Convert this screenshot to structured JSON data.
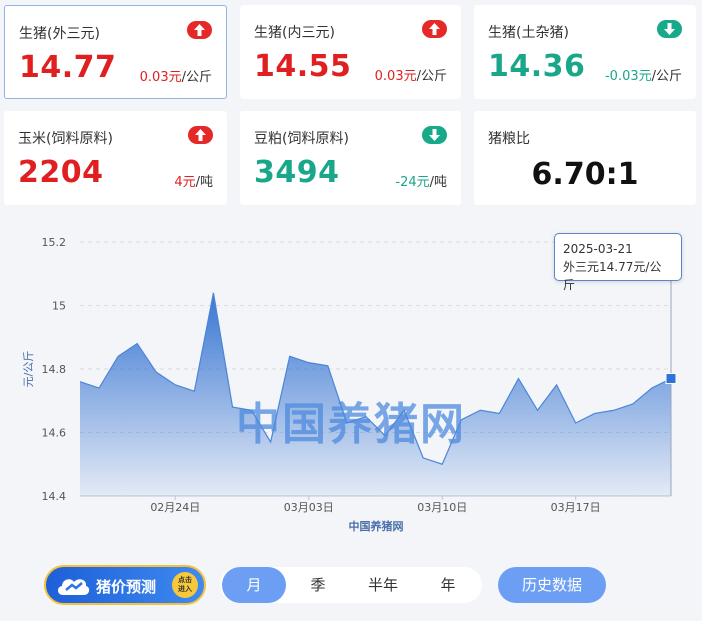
{
  "cards": [
    {
      "label": "生猪(外三元)",
      "value": "14.77",
      "change": "0.03元",
      "unit": "/公斤",
      "trend": "up"
    },
    {
      "label": "生猪(内三元)",
      "value": "14.55",
      "change": "0.03元",
      "unit": "/公斤",
      "trend": "up"
    },
    {
      "label": "生猪(土杂猪)",
      "value": "14.36",
      "change": "-0.03元",
      "unit": "/公斤",
      "trend": "down"
    },
    {
      "label": "玉米(饲料原料)",
      "value": "2204",
      "change": "4元",
      "unit": "/吨",
      "trend": "up"
    },
    {
      "label": "豆粕(饲料原料)",
      "value": "3494",
      "change": "-24元",
      "unit": "/吨",
      "trend": "down"
    },
    {
      "label": "猪粮比",
      "value": "6.70:1"
    }
  ],
  "tooltip": {
    "date": "2025-03-21",
    "text": "外三元14.77元/公斤"
  },
  "watermark": "中国养猪网",
  "promo": {
    "text": "猪价预测",
    "badge_line1": "点击",
    "badge_line2": "进入"
  },
  "range_tabs": [
    {
      "label": "月",
      "active": true
    },
    {
      "label": "季",
      "active": false
    },
    {
      "label": "半年",
      "active": false
    },
    {
      "label": "年",
      "active": false
    }
  ],
  "history_button": "历史数据",
  "chart_data": {
    "type": "area",
    "ylabel": "元/公斤",
    "xlabel": "中国养猪网",
    "ylim": [
      14.4,
      15.2
    ],
    "yticks": [
      14.4,
      14.6,
      14.8,
      15,
      15.2
    ],
    "xticks": [
      {
        "label": "02月24日",
        "index": 5
      },
      {
        "label": "03月03日",
        "index": 12
      },
      {
        "label": "03月10日",
        "index": 19
      },
      {
        "label": "03月17日",
        "index": 26
      }
    ],
    "series": [
      {
        "values": [
          14.76,
          14.74,
          14.84,
          14.88,
          14.79,
          14.75,
          14.73,
          15.04,
          14.68,
          14.67,
          14.57,
          14.84,
          14.82,
          14.81,
          14.63,
          14.65,
          14.59,
          14.67,
          14.52,
          14.5,
          14.64,
          14.67,
          14.66,
          14.77,
          14.67,
          14.75,
          14.63,
          14.66,
          14.67,
          14.69,
          14.74,
          14.77
        ]
      }
    ],
    "color": "#4a86d8"
  }
}
